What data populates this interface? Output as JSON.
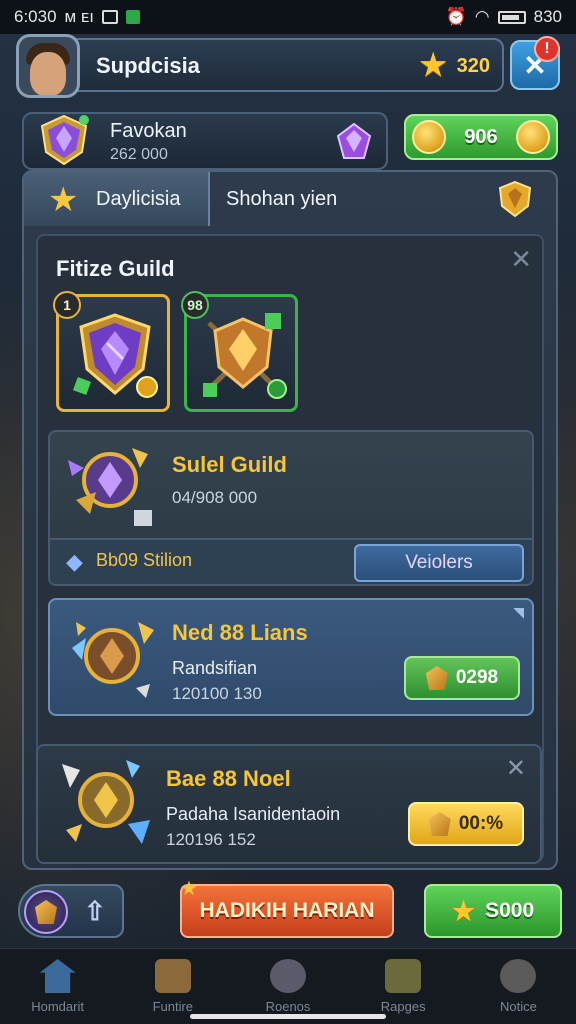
{
  "status_bar": {
    "time": "6:030",
    "left_glyphs": "ᴍ ᴇı",
    "right_time": "830"
  },
  "profile": {
    "name": "Supdcisia",
    "stars": "320"
  },
  "notification": {
    "count": "!"
  },
  "favor": {
    "title": "Favokan",
    "value": "262 000"
  },
  "coins": {
    "value": "906"
  },
  "tabs": {
    "daily": "Daylicisia",
    "other": "Shohan yien"
  },
  "section": {
    "title": "Fitize Guild"
  },
  "cards": [
    {
      "badge": "1",
      "frame": "gold"
    },
    {
      "badge": "98",
      "frame": "green"
    }
  ],
  "rows": [
    {
      "title": "Sulel Guild",
      "number": "04/908 000",
      "footer_label": "Bb09 Stilion",
      "button": "Veiolers"
    },
    {
      "title": "Ned 88 Lians",
      "subtitle": "Randsifian",
      "number": "120100 130",
      "price": "0298"
    },
    {
      "title": "Bae 88 Noel",
      "subtitle": "Padaha Isanidentaoin",
      "number": "120196 152",
      "price": "00:%"
    }
  ],
  "actions": {
    "orange_button": "HADIKIH HARIAN",
    "green_button": "S000"
  },
  "nav": [
    {
      "label": "Homdarit",
      "color": "#3c6a9a"
    },
    {
      "label": "Funtire",
      "color": "#8a6a3a"
    },
    {
      "label": "Roenos",
      "color": "#5a5a6a"
    },
    {
      "label": "Rapges",
      "color": "#6a6a3a"
    },
    {
      "label": "Notice",
      "color": "#5a5a5a"
    }
  ]
}
